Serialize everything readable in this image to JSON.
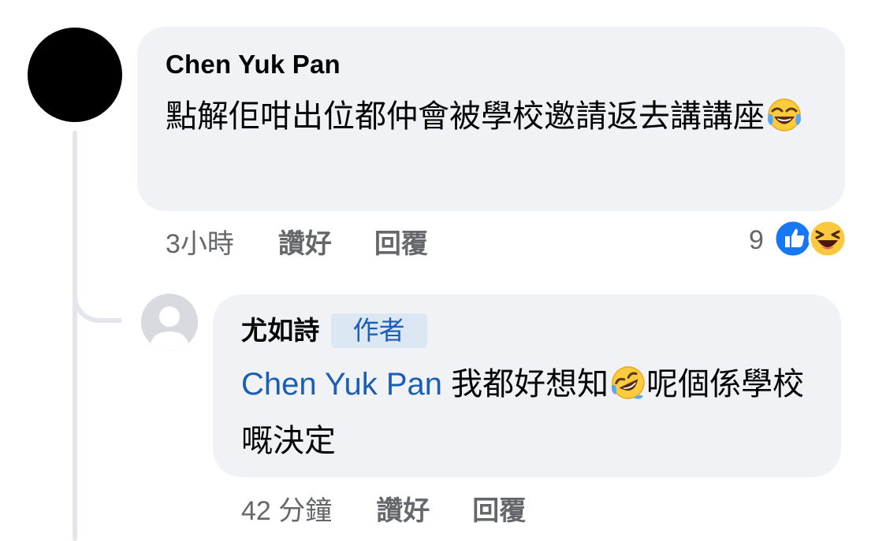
{
  "comment": {
    "author": "Chen Yuk Pan",
    "text_before_emoji": "點解佢咁出位都仲會被學校邀請返去講講座",
    "emoji": "tears-of-joy-emoji",
    "timestamp": "3小時",
    "like_label": "讚好",
    "reply_label": "回覆",
    "reaction_count": "9",
    "reaction_icons": [
      "like-reaction-icon",
      "haha-reaction-icon"
    ]
  },
  "reply": {
    "author": "尤如詩",
    "author_badge": "作者",
    "mention": "Chen Yuk Pan",
    "text_part1": "我都好想知",
    "emoji": "rolling-on-floor-laughing-emoji",
    "text_part2": "呢個係學校嘅決定",
    "timestamp": "42 分鐘",
    "like_label": "讚好",
    "reply_label": "回覆"
  },
  "colors": {
    "bubble_bg": "#f0f2f5",
    "meta_text": "#65676b",
    "mention_link": "#1a5fb4",
    "badge_bg": "#dbe7f2",
    "badge_text": "#1c5fb8",
    "like_blue": "#1877f2"
  }
}
